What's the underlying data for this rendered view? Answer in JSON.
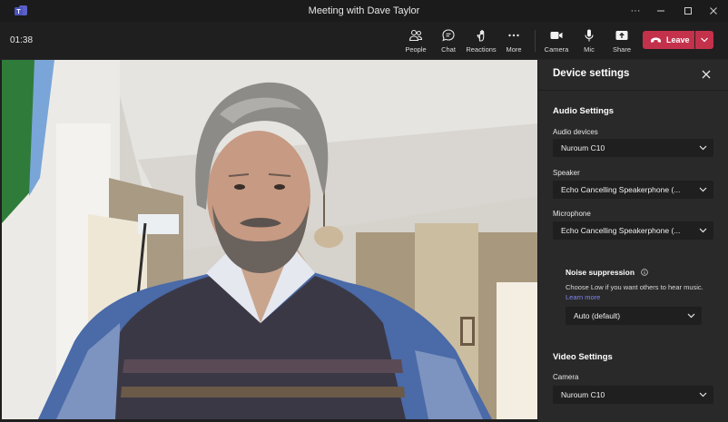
{
  "window": {
    "title": "Meeting with Dave Taylor",
    "controls": {
      "more": "···"
    }
  },
  "toolbar": {
    "timer": "01:38",
    "people_label": "People",
    "chat_label": "Chat",
    "reactions_label": "Reactions",
    "more_label": "More",
    "camera_label": "Camera",
    "mic_label": "Mic",
    "share_label": "Share",
    "leave_label": "Leave"
  },
  "device_settings": {
    "title": "Device settings",
    "audio_section": "Audio Settings",
    "audio_devices_label": "Audio devices",
    "audio_devices_value": "Nuroum C10",
    "speaker_label": "Speaker",
    "speaker_value": "Echo Cancelling Speakerphone (...",
    "microphone_label": "Microphone",
    "microphone_value": "Echo Cancelling Speakerphone (...",
    "noise_title": "Noise suppression",
    "noise_desc": "Choose Low if you want others to hear music.",
    "learn_more": "Learn more",
    "noise_value": "Auto (default)",
    "video_section": "Video Settings",
    "camera_label": "Camera",
    "camera_value": "Nuroum C10"
  },
  "colors": {
    "leave_red": "#c4314b",
    "link_purple": "#7f85f5",
    "panel_bg": "#292929"
  }
}
